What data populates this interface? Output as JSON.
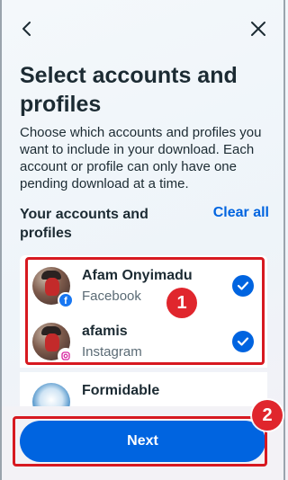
{
  "header": {
    "back_icon": "chevron-left-icon",
    "close_icon": "close-icon"
  },
  "title": "Select accounts and profiles",
  "description": "Choose which accounts and profiles you want to include in your download. Each account or profile can only have one pending download at a time.",
  "section": {
    "title": "Your accounts and profiles",
    "clear_all": "Clear all"
  },
  "accounts": [
    {
      "name": "Afam Onyimadu",
      "platform": "Facebook",
      "selected": true,
      "badge_icon": "facebook-icon"
    },
    {
      "name": "afamis",
      "platform": "Instagram",
      "selected": true,
      "badge_icon": "instagram-icon"
    },
    {
      "name": "Formidable",
      "platform": "",
      "selected": false
    }
  ],
  "annotations": {
    "marker1": "1",
    "marker2": "2"
  },
  "footer": {
    "next_label": "Next"
  },
  "colors": {
    "accent": "#0064e0",
    "highlight": "#d71920",
    "marker": "#e0262d"
  }
}
